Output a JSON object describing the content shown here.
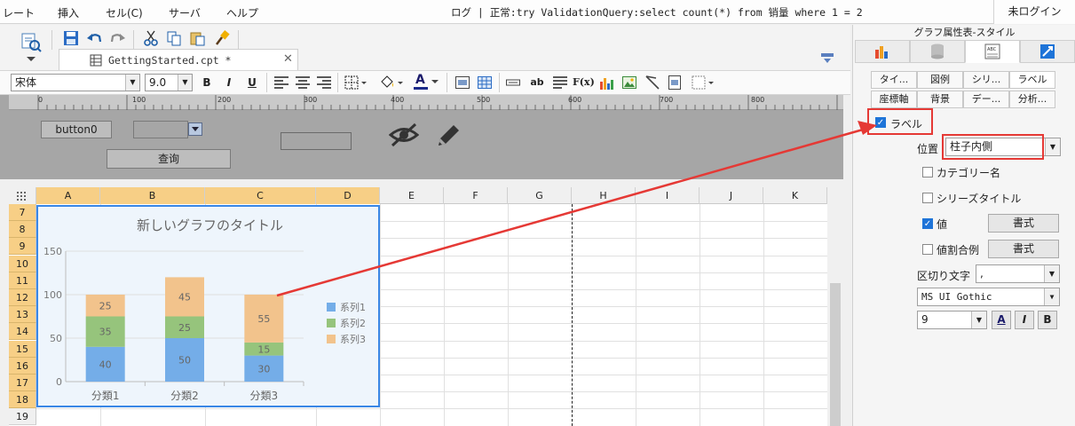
{
  "menubar": {
    "items": [
      "レート",
      "挿入",
      "セル(C)",
      "サーバ",
      "ヘルプ"
    ],
    "status": "ログ | 正常:try ValidationQuery:select count(*) from 销量 where 1 = 2",
    "login": "未ログイン"
  },
  "toolbar": {
    "file_tab": "GettingStarted.cpt *",
    "font_name": "宋体",
    "font_size": "9.0",
    "bold": "B",
    "italic": "I",
    "underline": "U",
    "ab": "ab",
    "fx": "F(x)",
    "font_color_label": "A"
  },
  "ruler": {
    "labels": [
      "0",
      "100",
      "200",
      "300",
      "400",
      "500",
      "600",
      "700",
      "800"
    ]
  },
  "design": {
    "button0": "button0",
    "query_button": "查询"
  },
  "grid": {
    "columns": [
      "A",
      "B",
      "C",
      "D",
      "E",
      "F",
      "G",
      "H",
      "I",
      "J",
      "K"
    ],
    "rows": [
      "7",
      "8",
      "9",
      "10",
      "11",
      "12",
      "13",
      "14",
      "15",
      "16",
      "17",
      "18",
      "19"
    ]
  },
  "chart_data": {
    "type": "bar",
    "stacked": true,
    "title": "新しいグラフのタイトル",
    "categories": [
      "分類1",
      "分類2",
      "分類3"
    ],
    "series": [
      {
        "name": "系列1",
        "values": [
          40,
          50,
          30
        ],
        "color": "#74ade8"
      },
      {
        "name": "系列2",
        "values": [
          35,
          25,
          15
        ],
        "color": "#96c47c"
      },
      {
        "name": "系列3",
        "values": [
          25,
          45,
          55
        ],
        "color": "#f2c38c"
      }
    ],
    "y_ticks": [
      "0",
      "50",
      "100",
      "150"
    ],
    "ylim": [
      0,
      150
    ],
    "grid": true,
    "legend_position": "right",
    "xlabel": "",
    "ylabel": ""
  },
  "panel": {
    "title": "グラフ属性表-スタイル",
    "subtabs_row1": [
      "タイ...",
      "図例",
      "シリ...",
      "ラベル"
    ],
    "subtabs_row2": [
      "座標軸",
      "背景",
      "デー...",
      "分析..."
    ],
    "label_checkbox": "ラベル",
    "position_label": "位置",
    "position_value": "柱子内側",
    "category_name": "カテゴリー名",
    "series_title": "シリーズタイトル",
    "value": "値",
    "format_button": "書式",
    "value_percent": "値割合例",
    "format_button2": "書式",
    "separator_label": "区切り文字",
    "separator_value": ",",
    "font_value": "MS UI Gothic",
    "font_size_value": "9",
    "font_a": "A",
    "font_i": "I",
    "font_b": "B"
  },
  "colors": {
    "accent": "#1e74d8",
    "highlight": "#e53935",
    "selected_header": "#f7cf86"
  }
}
